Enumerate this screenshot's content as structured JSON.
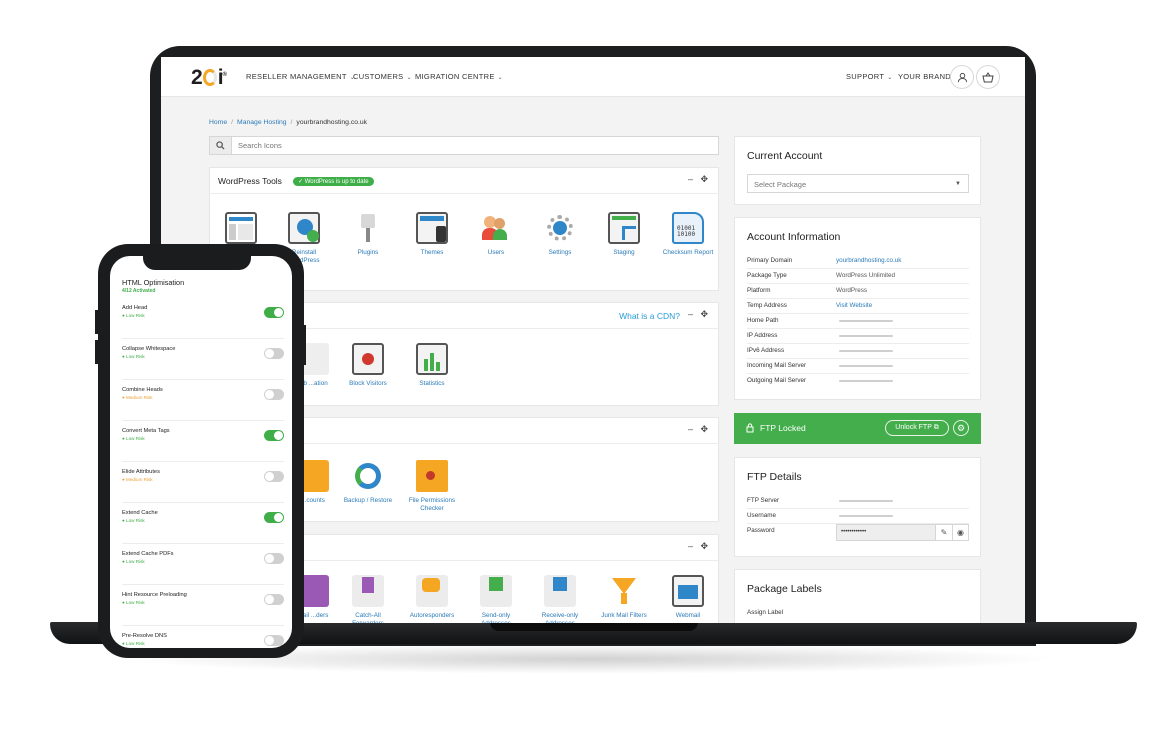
{
  "brand": {
    "logo_left": "2",
    "logo_right": "i",
    "logo_sup": "®"
  },
  "nav": {
    "items": [
      {
        "label": "RESELLER MANAGEMENT"
      },
      {
        "label": "CUSTOMERS"
      },
      {
        "label": "MIGRATION CENTRE"
      }
    ],
    "support": "SUPPORT",
    "your_brand": "YOUR BRAND"
  },
  "breadcrumb": {
    "home": "Home",
    "manage": "Manage Hosting",
    "current": "yourbrandhosting.co.uk"
  },
  "search": {
    "placeholder": "Search Icons"
  },
  "wordpress_tools": {
    "title": "WordPress Tools",
    "badge": "✓ WordPress is up to date",
    "tools": [
      {
        "label": ""
      },
      {
        "label": "Reinstall WordPress"
      },
      {
        "label": "Plugins"
      },
      {
        "label": "Themes"
      },
      {
        "label": "Users"
      },
      {
        "label": "Settings"
      },
      {
        "label": "Staging"
      },
      {
        "label": "Checksum Report"
      }
    ]
  },
  "cdn_panel": {
    "link": "What is a CDN?",
    "tools": [
      {
        "label": "...b ...ation"
      },
      {
        "label": "Block Visitors"
      },
      {
        "label": "Statistics"
      }
    ]
  },
  "files_panel": {
    "tools": [
      {
        "label": "...counts"
      },
      {
        "label": "Backup / Restore"
      },
      {
        "label": "File Permissions Checker"
      }
    ]
  },
  "email_panel": {
    "tools": [
      {
        "label": "...ail ...ders"
      },
      {
        "label": "Catch-All Forwarders"
      },
      {
        "label": "Autoresponders"
      },
      {
        "label": "Send-only Addresses"
      },
      {
        "label": "Receive-only Addresses"
      },
      {
        "label": "Junk Mail Filters"
      },
      {
        "label": "Webmail"
      }
    ]
  },
  "current_account": {
    "title": "Current Account",
    "select_value": "Select Package"
  },
  "account_info": {
    "title": "Account Information",
    "rows": [
      {
        "key": "Primary Domain",
        "value": "yourbrandhosting.co.uk"
      },
      {
        "key": "Package Type",
        "value": "WordPress Unlimited"
      },
      {
        "key": "Platform",
        "value": "WordPress"
      },
      {
        "key": "Temp Address",
        "value": "Visit Website"
      },
      {
        "key": "Home Path",
        "value": ""
      },
      {
        "key": "IP Address",
        "value": ""
      },
      {
        "key": "IPv6 Address",
        "value": ""
      },
      {
        "key": "Incoming Mail Server",
        "value": ""
      },
      {
        "key": "Outgoing Mail Server",
        "value": ""
      }
    ]
  },
  "ftp": {
    "locked_label": "FTP Locked",
    "unlock_label": "Unlock FTP",
    "details_title": "FTP Details",
    "server_label": "FTP Server",
    "username_label": "Username",
    "password_label": "Password",
    "password_value": "••••••••••••"
  },
  "package_labels": {
    "title": "Package Labels",
    "assign": "Assign Label"
  },
  "phone": {
    "title": "HTML Optimisation",
    "subtitle": "4/12 Activated",
    "options": [
      {
        "name": "Add Head",
        "risk": "● Low Risk",
        "level": "low",
        "on": true
      },
      {
        "name": "Collapse Whitespace",
        "risk": "● Low Risk",
        "level": "low",
        "on": false
      },
      {
        "name": "Combine Heads",
        "risk": "● Medium Risk",
        "level": "med",
        "on": false
      },
      {
        "name": "Convert Meta Tags",
        "risk": "● Low Risk",
        "level": "low",
        "on": true
      },
      {
        "name": "Elide Attributes",
        "risk": "● Medium Risk",
        "level": "med",
        "on": false
      },
      {
        "name": "Extend Cache",
        "risk": "● Low Risk",
        "level": "low",
        "on": true
      },
      {
        "name": "Extend Cache PDFs",
        "risk": "● Low Risk",
        "level": "low",
        "on": false
      },
      {
        "name": "Hint Resource Preloading",
        "risk": "● Low Risk",
        "level": "low",
        "on": false
      },
      {
        "name": "Pre-Resolve DNS",
        "risk": "● Low Risk",
        "level": "low",
        "on": false
      }
    ]
  },
  "colors": {
    "accent_green": "#43ae4b",
    "link_blue": "#2a7ab8",
    "logo_orange": "#f5a623"
  }
}
